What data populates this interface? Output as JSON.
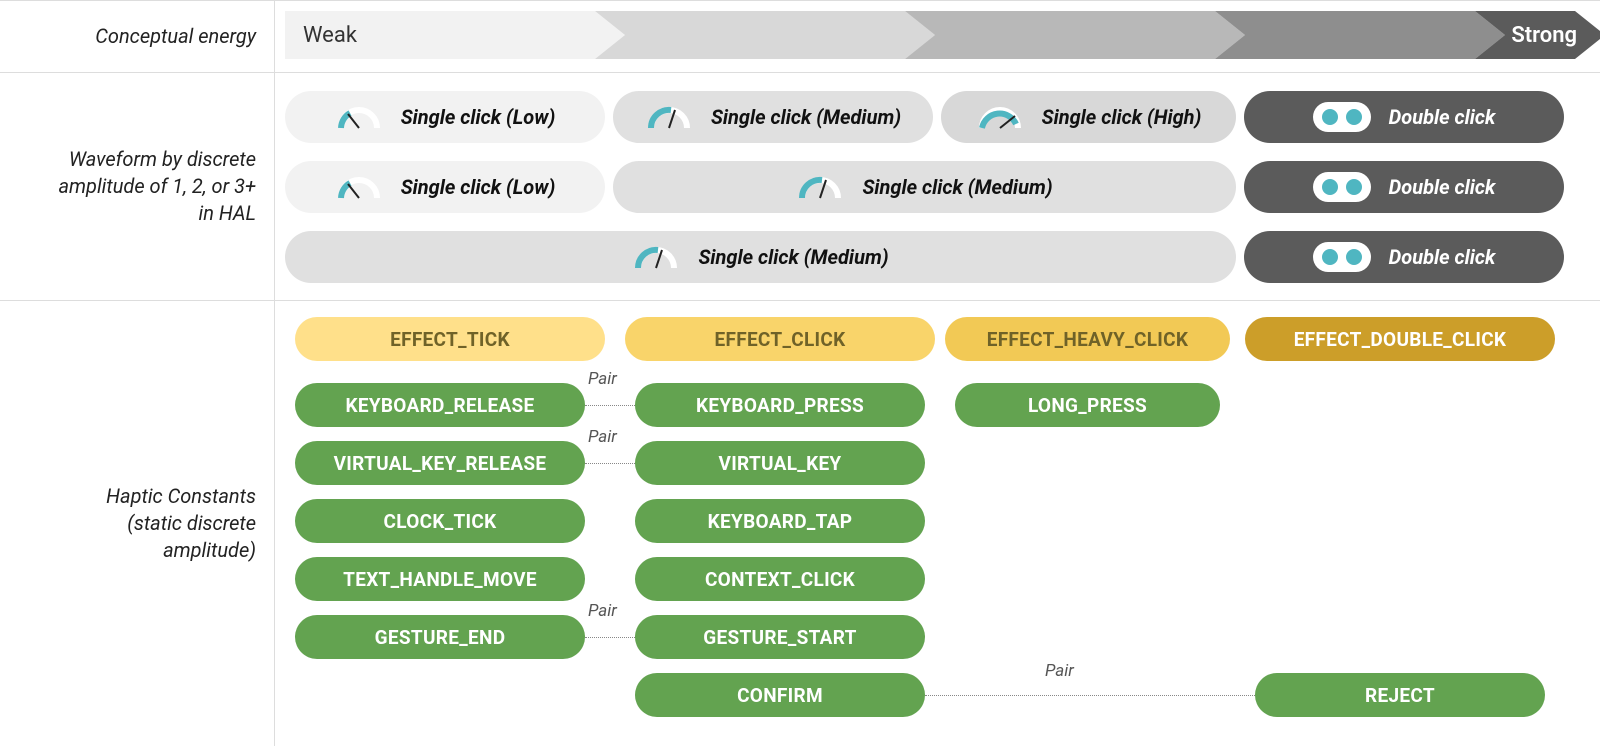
{
  "header": {
    "label": "Conceptual energy",
    "weak": "Weak",
    "strong": "Strong"
  },
  "waveform": {
    "label_l1": "Waveform by discrete",
    "label_l2": "amplitude of 1, 2, or 3+",
    "label_l3": "in HAL",
    "clicks": {
      "low": "Single click (Low)",
      "med": "Single click (Medium)",
      "high": "Single click (High)",
      "double": "Double click"
    }
  },
  "constants": {
    "label_l1": "Haptic Constants",
    "label_l2": "(static discrete",
    "label_l3": "amplitude)",
    "pair": "Pair",
    "effects": {
      "tick": "EFFECT_TICK",
      "click": "EFFECT_CLICK",
      "heavy": "EFFECT_HEAVY_CLICK",
      "double": "EFFECT_DOUBLE_CLICK"
    },
    "green": {
      "kb_release": "KEYBOARD_RELEASE",
      "kb_press": "KEYBOARD_PRESS",
      "long_press": "LONG_PRESS",
      "vk_release": "VIRTUAL_KEY_RELEASE",
      "vk": "VIRTUAL_KEY",
      "clock_tick": "CLOCK_TICK",
      "kb_tap": "KEYBOARD_TAP",
      "text_handle": "TEXT_HANDLE_MOVE",
      "ctx_click": "CONTEXT_CLICK",
      "gesture_end": "GESTURE_END",
      "gesture_start": "GESTURE_START",
      "confirm": "CONFIRM",
      "reject": "REJECT"
    }
  },
  "colors": {
    "arrow": [
      "#f2f2f2",
      "#d8d8d8",
      "#b8b8b8",
      "#8e8e8e",
      "#5b5b5b"
    ],
    "teal": "#4fb6c1",
    "green": "#63a350",
    "gold": "#cc9e29"
  }
}
